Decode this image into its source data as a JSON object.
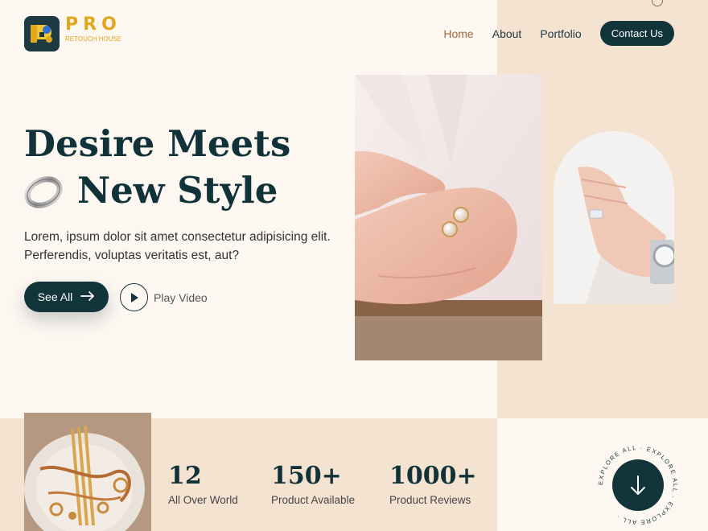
{
  "brand": {
    "name": "PRO",
    "tagline": "RETOUCH HOUSE",
    "accent": "#e2a81d"
  },
  "colors": {
    "primary": "#12343b",
    "panel": "#f5e3d1",
    "background": "#fdf7f1",
    "active_nav": "#a0683c"
  },
  "nav": {
    "home": "Home",
    "about": "About",
    "portfolio": "Portfolio",
    "contact": "Contact Us",
    "active": "Home"
  },
  "hero": {
    "title_line1": "Desire Meets",
    "title_line2": "New Style",
    "description": "Lorem, ipsum dolor sit amet consectetur adipisicing elit. Perferendis, voluptas veritatis est, aut?",
    "see_all_label": "See All",
    "play_video_label": "Play Video"
  },
  "stats": [
    {
      "value": "12",
      "label": "All Over World"
    },
    {
      "value": "150+",
      "label": "Product Available"
    },
    {
      "value": "1000+",
      "label": "Product Reviews"
    }
  ],
  "explore": {
    "ring_text": "EXPLORE ALL · EXPLORE ALL · EXPLORE ALL · "
  },
  "icons": {
    "logo": "logo-mark-icon",
    "ring": "ring-icon",
    "arrow": "arrow-right-icon",
    "play": "play-icon",
    "down": "arrow-down-icon"
  }
}
